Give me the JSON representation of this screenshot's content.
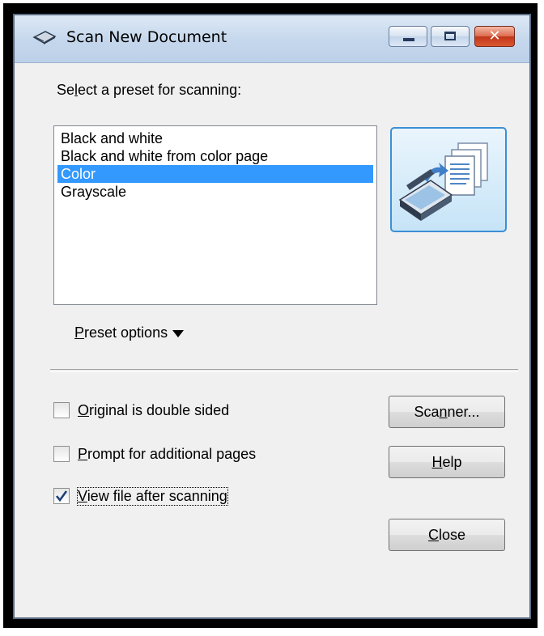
{
  "window": {
    "title": "Scan New Document",
    "controls": {
      "minimize": "minimize",
      "maximize": "maximize",
      "close": "✕"
    }
  },
  "preset": {
    "label": "Select a preset for scanning:",
    "items": [
      {
        "label": "Black and white",
        "selected": false
      },
      {
        "label": "Black and white from color page",
        "selected": false
      },
      {
        "label": "Color",
        "selected": true
      },
      {
        "label": "Grayscale",
        "selected": false
      }
    ],
    "options_pre": "P",
    "options_rest": "reset options"
  },
  "checkboxes": [
    {
      "mn": "O",
      "rest": "riginal is double sided",
      "checked": false
    },
    {
      "mn": "P",
      "rest": "rompt for additional pages",
      "checked": false
    },
    {
      "mn": "V",
      "rest": "iew file after scanning",
      "checked": true
    }
  ],
  "buttons": {
    "scanner": {
      "pre": "Sca",
      "mn": "n",
      "post": "ner..."
    },
    "help": {
      "pre": "",
      "mn": "H",
      "post": "elp"
    },
    "close": {
      "pre": "",
      "mn": "C",
      "post": "lose"
    }
  },
  "icons": {
    "window": "scanner-icon",
    "tile": "scan-to-documents-icon",
    "dropdown": "triangle-down-icon",
    "check": "checkmark-icon"
  }
}
